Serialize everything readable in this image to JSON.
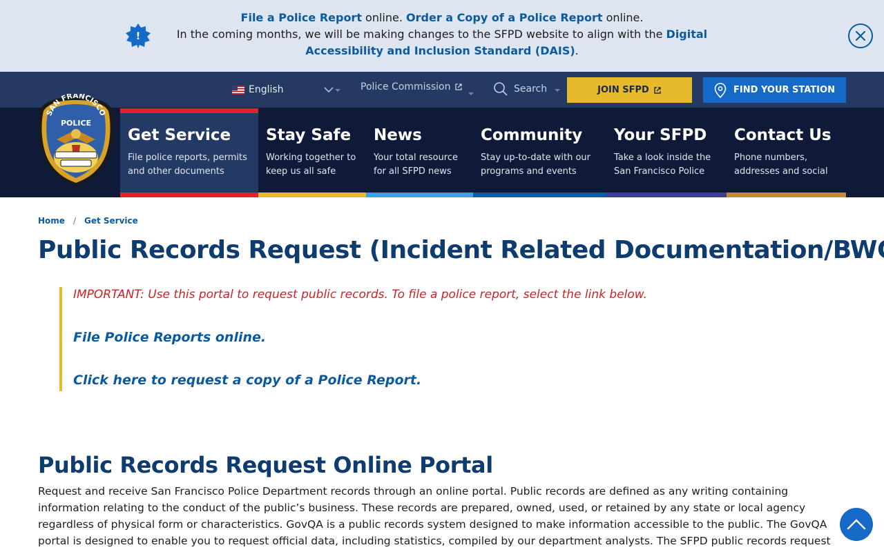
{
  "alert": {
    "line1_link1": "File a Police Report",
    "line1_text1": " online. ",
    "line1_link2": "Order a Copy of a Police Report",
    "line1_text2": " online.",
    "line2_text": "In the coming months, we will be making changes to the SFPD website to align with the ",
    "line2_link": "Digital Accessibility and Inclusion Standard (DAIS)",
    "line2_end": "."
  },
  "utility": {
    "language": "English",
    "police_commission": "Police Commission",
    "search": "Search",
    "join": "JOIN SFPD",
    "find_station": "FIND YOUR STATION"
  },
  "logo": {
    "top_text": "SAN FRANCISCO",
    "middle_text": "POLICE"
  },
  "nav": [
    {
      "title": "Get Service",
      "desc": "File police reports, permits and other documents",
      "color": "#e0222a"
    },
    {
      "title": "Stay Safe",
      "desc": "Working together to keep us all safe",
      "color": "#e7b92c"
    },
    {
      "title": "News",
      "desc": "Your total resource for all SFPD news",
      "color": "#3ba0e6"
    },
    {
      "title": "Community",
      "desc": "Stay up-to-date with our programs and events",
      "color": "#1059a8"
    },
    {
      "title": "Your SFPD",
      "desc": "Take a look inside the San Francisco Police",
      "color": "#3e3f8f"
    },
    {
      "title": "Contact Us",
      "desc": "Phone numbers, addresses and social",
      "color": "#c08a3e"
    }
  ],
  "breadcrumb": {
    "home": "Home",
    "separator": "/",
    "current": "Get Service"
  },
  "page_title": "Public Records Request (Incident Related Documentation/BWC)",
  "callout": {
    "warning": "IMPORTANT: Use this portal to request public records. To file a police report, select the link below.",
    "link1": "File Police Reports online.",
    "link2": "Click here to request a copy of a Police Report."
  },
  "section_title": "Public Records Request Online Portal",
  "body_text": "Request and receive San Francisco Police Department records through an online portal. Public records are defined as any writing containing information relating to the conduct of the public’s business. These records are prepared, owned, used, or retained by any state or local agency regardless of physical form or characteristics. GovQA is a public records system designed to make information accessible to the public. The GovQA portal is designed to enable you to request official data, including statistics, compiled by our department analysts. The SFPD public records request portal button below will link you to",
  "colors": {
    "brand_navy": "#0e1a38",
    "utility_bar": "#243a63",
    "accent_blue": "#1569c7",
    "accent_gold": "#e7b92c",
    "alert_bg": "#dde5f0",
    "warning_red": "#d01f24",
    "heading": "#0f3c6e"
  }
}
